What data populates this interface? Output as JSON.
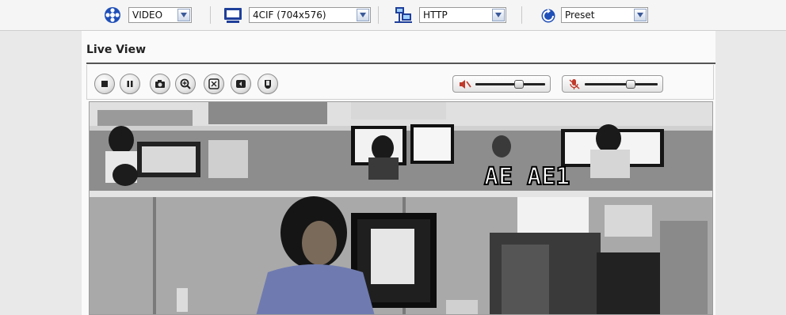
{
  "toolbar": {
    "video_mode": {
      "value": "VIDEO",
      "icon": "film-reel-icon"
    },
    "resolution": {
      "value": "4CIF (704x576)",
      "icon": "monitor-icon"
    },
    "protocol": {
      "value": "HTTP",
      "icon": "network-computers-icon"
    },
    "preset": {
      "value": "Preset",
      "icon": "refresh-icon"
    }
  },
  "live_view": {
    "title": "Live View",
    "controls": [
      {
        "name": "stop-button",
        "icon": "stop-icon"
      },
      {
        "name": "pause-button",
        "icon": "pause-icon"
      },
      {
        "name": "snapshot-button",
        "icon": "camera-icon"
      },
      {
        "name": "zoom-button",
        "icon": "zoom-in-icon"
      },
      {
        "name": "fullscreen-button",
        "icon": "fullscreen-icon"
      },
      {
        "name": "record-button",
        "icon": "record-icon"
      },
      {
        "name": "alarm-button",
        "icon": "alarm-icon"
      }
    ],
    "speaker_volume": {
      "icon": "speaker-muted-icon",
      "level": 0.65
    },
    "mic_volume": {
      "icon": "microphone-muted-icon",
      "level": 0.65
    },
    "video_overlay": "AE AE1"
  }
}
